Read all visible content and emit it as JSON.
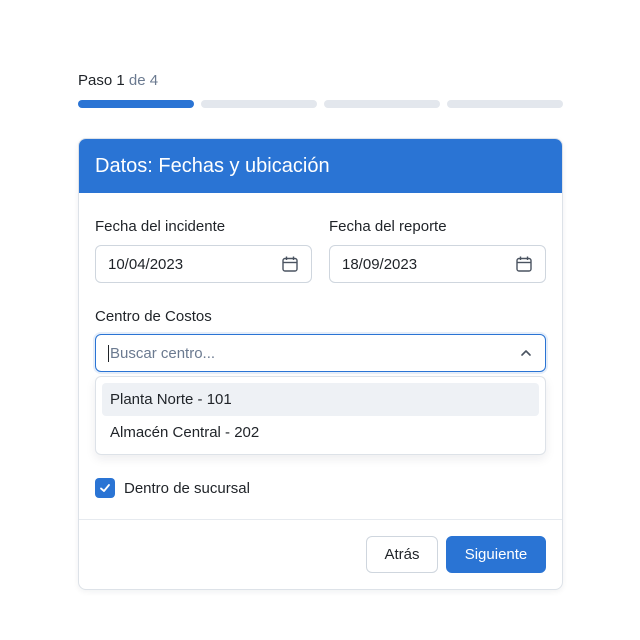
{
  "stepper": {
    "prefix": "Paso",
    "current": "1",
    "separator": "de 4",
    "total_steps": 4,
    "completed_steps": 1
  },
  "card": {
    "title": "Datos: Fechas y ubicación"
  },
  "fields": {
    "incident_date": {
      "label": "Fecha del incidente",
      "value": "10/04/2023",
      "icon": "calendar-icon"
    },
    "report_date": {
      "label": "Fecha del reporte",
      "value": "18/09/2023",
      "icon": "calendar-icon"
    },
    "cost_center": {
      "label": "Centro de Costos",
      "placeholder": "Buscar centro...",
      "icon": "chevron-up-icon",
      "options": [
        {
          "label": "Planta Norte - 101",
          "highlighted": true
        },
        {
          "label": "Almacén Central - 202",
          "highlighted": false
        }
      ]
    },
    "inside_branch": {
      "label": "Dentro de sucursal",
      "checked": true
    }
  },
  "footer": {
    "back_label": "Atrás",
    "next_label": "Siguiente"
  },
  "colors": {
    "accent": "#2a74d4",
    "track": "#e3e7ed",
    "highlight": "#eef1f5"
  }
}
